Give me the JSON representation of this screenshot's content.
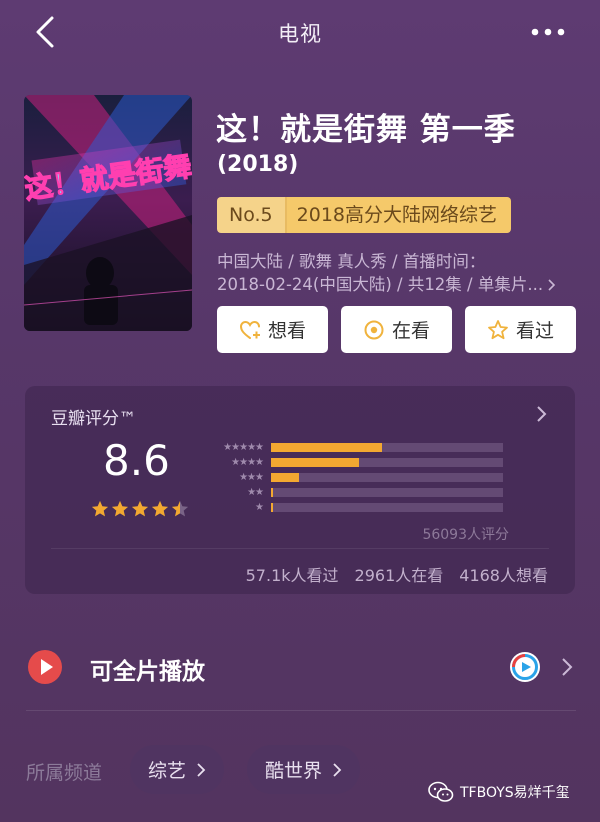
{
  "header": {
    "title": "电视"
  },
  "movie": {
    "title": "这！就是街舞 第一季",
    "year": "(2018)",
    "rank_no": "No.5",
    "rank_text": "2018高分大陆网络综艺",
    "meta_line1": "中国大陆 / 歌舞 真人秀 / 首播时间：",
    "meta_line2": "2018-02-24(中国大陆) / 共12集 / 单集片...",
    "poster_logo_text": "这！就是街舞"
  },
  "actions": {
    "want": "想看",
    "watching": "在看",
    "watched": "看过"
  },
  "rating": {
    "label": "豆瓣评分™",
    "score": "8.6",
    "stars_value": 4.5,
    "distribution": [
      {
        "stars": "★★★★★",
        "fraction": 0.48
      },
      {
        "stars": "★★★★",
        "fraction": 0.38
      },
      {
        "stars": "★★★",
        "fraction": 0.12
      },
      {
        "stars": "★★",
        "fraction": 0.01
      },
      {
        "stars": "★",
        "fraction": 0.01
      }
    ],
    "count": "56093人评分",
    "watched": "57.1k人看过",
    "watching": "2961人在看",
    "want": "4168人想看"
  },
  "play": {
    "label": "可全片播放"
  },
  "channels": {
    "label": "所属频道",
    "items": [
      "综艺",
      "酷世界"
    ]
  },
  "watermark": {
    "text": "TFBOYS易烊千玺"
  },
  "colors": {
    "accent": "#f3a831",
    "background": "#5b3a6f",
    "badge": "#f5c96a",
    "play_red": "#e54b4b"
  }
}
